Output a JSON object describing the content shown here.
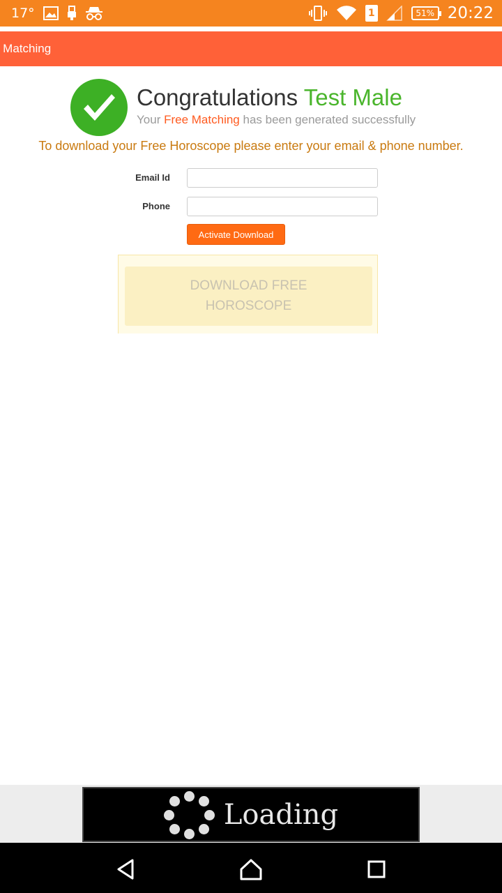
{
  "status_bar": {
    "temperature": "17°",
    "battery": "51%",
    "sim_slot": "1",
    "time": "20:22",
    "icons": [
      "image-icon",
      "usb-icon",
      "incognito-icon",
      "vibrate-icon",
      "wifi-icon",
      "sim-icon",
      "signal-icon",
      "battery-icon"
    ]
  },
  "app_bar": {
    "title": "e Matching"
  },
  "header": {
    "congrats_word": "Congratulations",
    "user_name": "Test Male",
    "sub_prefix": "Your",
    "sub_accent": "Free Matching",
    "sub_suffix": "has been generated successfully"
  },
  "instruction": "To download your Free Horoscope please enter your email & phone number.",
  "form": {
    "email_label": "Email Id",
    "email_value": "",
    "phone_label": "Phone",
    "phone_value": "",
    "activate_button": "Activate Download"
  },
  "download": {
    "line1": "DOWNLOAD FREE",
    "line2": "HOROSCOPE"
  },
  "loading": {
    "text": "Loading"
  },
  "colors": {
    "status_bar": "#f5841f",
    "app_bar": "#ff6138",
    "success_green": "#3db025",
    "accent_orange": "#ff6a13",
    "instruction_text": "#c97a10"
  }
}
